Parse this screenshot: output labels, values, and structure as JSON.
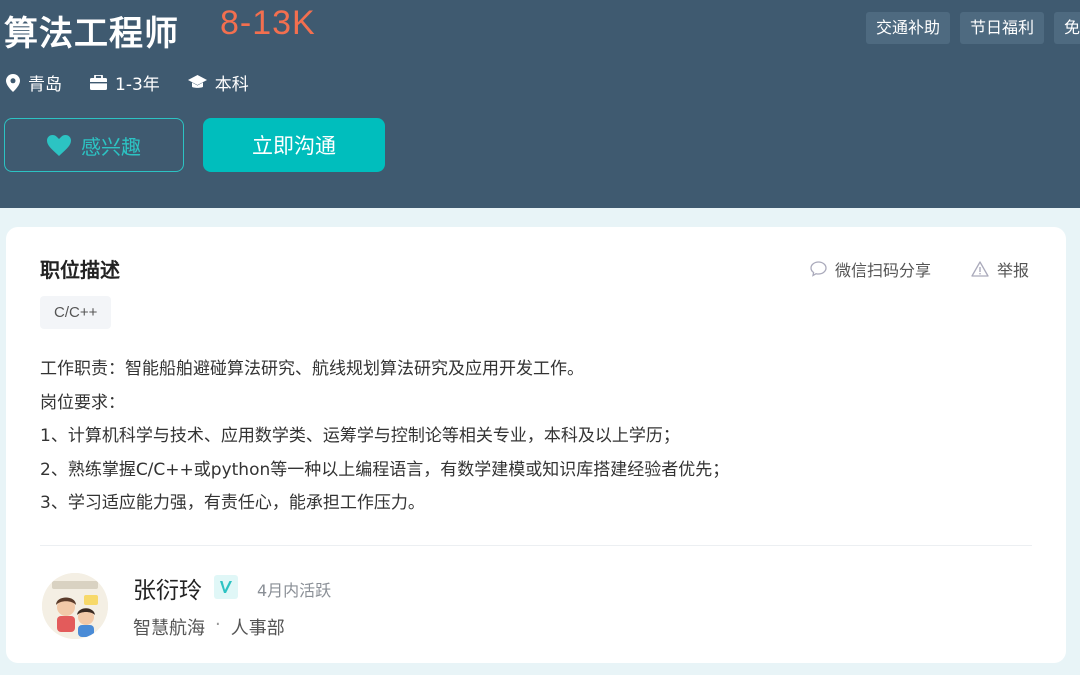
{
  "job": {
    "title": "算法工程师",
    "salary": "8-13K",
    "benefits": [
      "交通补助",
      "节日福利",
      "免"
    ],
    "location": "青岛",
    "experience": "1-3年",
    "education": "本科"
  },
  "actions": {
    "interest_label": "感兴趣",
    "chat_label": "立即沟通"
  },
  "section": {
    "title": "职位描述",
    "share_label": "微信扫码分享",
    "report_label": "举报",
    "skill_tag": "C/C++",
    "description": [
      "工作职责：智能船舶避碰算法研究、航线规划算法研究及应用开发工作。",
      "岗位要求：",
      "1、计算机科学与技术、应用数学类、运筹学与控制论等相关专业，本科及以上学历；",
      "2、熟练掌握C/C++或python等一种以上编程语言，有数学建模或知识库搭建经验者优先；",
      "3、学习适应能力强，有责任心，能承担工作压力。"
    ]
  },
  "recruiter": {
    "name": "张衍玲",
    "active_status": "4月内活跃",
    "company": "智慧航海",
    "separator": "·",
    "department": "人事部"
  },
  "colors": {
    "header_bg": "#3f5a70",
    "salary": "#f36f4f",
    "accent": "#00bebd"
  }
}
